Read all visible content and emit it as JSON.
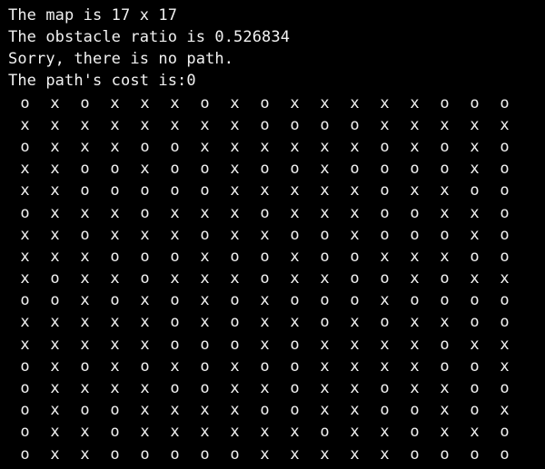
{
  "console": {
    "lines": [
      "The map is 17 x 17",
      "The obstacle ratio is 0.526834",
      "Sorry, there is no path.",
      "The path's cost is:0"
    ],
    "grid": [
      [
        "o",
        "x",
        "o",
        "x",
        "x",
        "x",
        "o",
        "x",
        "o",
        "x",
        "x",
        "x",
        "x",
        "x",
        "o",
        "o",
        "o"
      ],
      [
        "x",
        "x",
        "x",
        "x",
        "x",
        "x",
        "x",
        "x",
        "o",
        "o",
        "o",
        "o",
        "x",
        "x",
        "x",
        "x",
        "x"
      ],
      [
        "o",
        "x",
        "x",
        "x",
        "o",
        "o",
        "x",
        "x",
        "x",
        "x",
        "x",
        "x",
        "o",
        "x",
        "o",
        "x",
        "o"
      ],
      [
        "x",
        "x",
        "o",
        "o",
        "x",
        "o",
        "o",
        "x",
        "o",
        "o",
        "x",
        "o",
        "o",
        "o",
        "o",
        "x",
        "o"
      ],
      [
        "x",
        "x",
        "o",
        "o",
        "o",
        "o",
        "o",
        "x",
        "x",
        "x",
        "x",
        "x",
        "o",
        "x",
        "x",
        "o",
        "o"
      ],
      [
        "o",
        "x",
        "x",
        "x",
        "o",
        "x",
        "x",
        "x",
        "o",
        "x",
        "x",
        "x",
        "o",
        "o",
        "x",
        "x",
        "o"
      ],
      [
        "x",
        "x",
        "o",
        "x",
        "x",
        "x",
        "o",
        "x",
        "x",
        "o",
        "o",
        "x",
        "o",
        "o",
        "o",
        "x",
        "o"
      ],
      [
        "x",
        "x",
        "x",
        "o",
        "o",
        "o",
        "x",
        "o",
        "o",
        "x",
        "o",
        "o",
        "x",
        "x",
        "x",
        "o",
        "o"
      ],
      [
        "x",
        "o",
        "x",
        "x",
        "o",
        "x",
        "x",
        "x",
        "o",
        "x",
        "x",
        "o",
        "o",
        "x",
        "o",
        "x",
        "x"
      ],
      [
        "o",
        "o",
        "x",
        "o",
        "x",
        "o",
        "x",
        "o",
        "x",
        "o",
        "o",
        "o",
        "x",
        "o",
        "o",
        "o",
        "o"
      ],
      [
        "x",
        "x",
        "x",
        "x",
        "x",
        "o",
        "x",
        "o",
        "x",
        "x",
        "o",
        "x",
        "o",
        "x",
        "x",
        "o",
        "o"
      ],
      [
        "x",
        "x",
        "x",
        "x",
        "x",
        "o",
        "o",
        "o",
        "x",
        "o",
        "x",
        "x",
        "x",
        "x",
        "o",
        "x",
        "x"
      ],
      [
        "o",
        "x",
        "o",
        "x",
        "o",
        "x",
        "o",
        "x",
        "o",
        "o",
        "x",
        "x",
        "x",
        "x",
        "o",
        "o",
        "x"
      ],
      [
        "o",
        "x",
        "x",
        "x",
        "x",
        "o",
        "o",
        "x",
        "x",
        "o",
        "x",
        "x",
        "o",
        "x",
        "x",
        "o",
        "o"
      ],
      [
        "o",
        "x",
        "o",
        "o",
        "x",
        "x",
        "x",
        "x",
        "o",
        "o",
        "x",
        "x",
        "o",
        "o",
        "x",
        "o",
        "x"
      ],
      [
        "o",
        "x",
        "x",
        "o",
        "x",
        "x",
        "x",
        "x",
        "x",
        "x",
        "o",
        "x",
        "x",
        "o",
        "x",
        "x",
        "o"
      ],
      [
        "o",
        "x",
        "x",
        "o",
        "o",
        "o",
        "o",
        "o",
        "x",
        "x",
        "x",
        "x",
        "x",
        "o",
        "o",
        "o",
        "o"
      ]
    ]
  }
}
